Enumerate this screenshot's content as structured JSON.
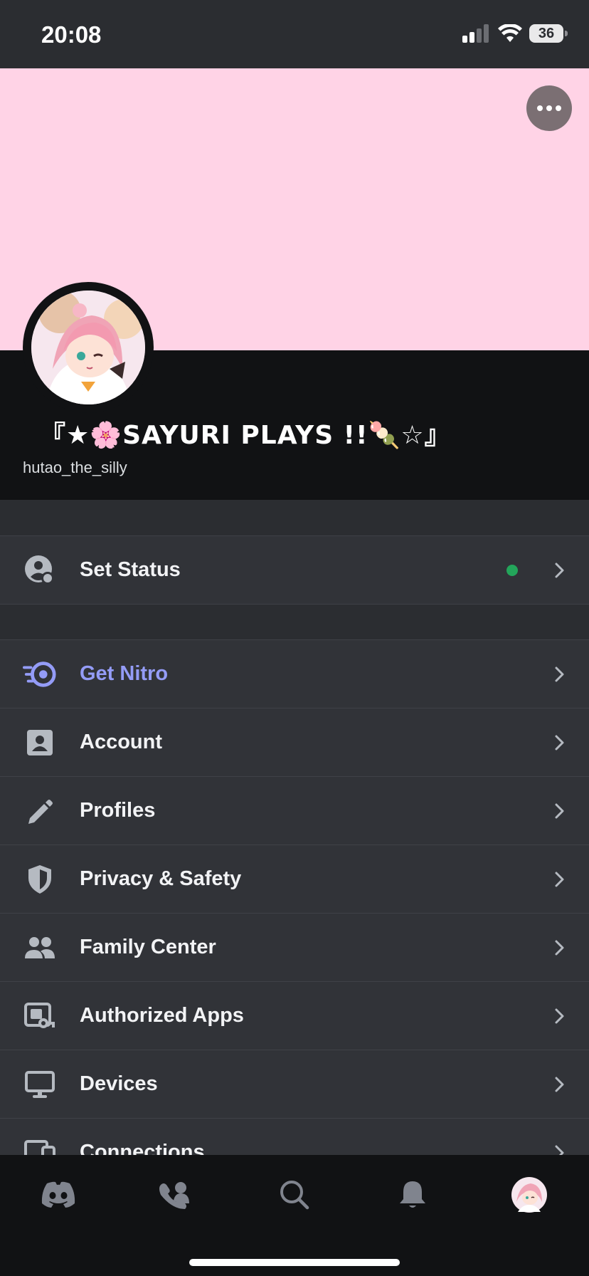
{
  "status_bar": {
    "time": "20:08",
    "battery": "36"
  },
  "profile": {
    "display_name": "『★🌸SAYURI PLAYS !!🍡☆』",
    "username": "hutao_the_silly"
  },
  "status_section": {
    "label": "Set Status",
    "status_color": "#23a55a"
  },
  "settings": [
    {
      "label": "Get Nitro",
      "icon": "nitro-icon"
    },
    {
      "label": "Account",
      "icon": "account-icon"
    },
    {
      "label": "Profiles",
      "icon": "pencil-icon"
    },
    {
      "label": "Privacy & Safety",
      "icon": "shield-icon"
    },
    {
      "label": "Family Center",
      "icon": "family-icon"
    },
    {
      "label": "Authorized Apps",
      "icon": "apps-key-icon"
    },
    {
      "label": "Devices",
      "icon": "monitor-icon"
    },
    {
      "label": "Connections",
      "icon": "connections-icon"
    }
  ],
  "tabs": [
    "home-tab",
    "friends-tab",
    "search-tab",
    "notifications-tab",
    "profile-tab"
  ],
  "colors": {
    "accent": "#949cf7",
    "banner": "#ffd3e6",
    "background": "#313338"
  }
}
